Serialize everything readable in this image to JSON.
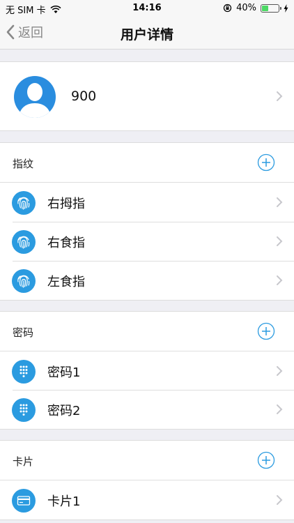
{
  "status_bar": {
    "carrier": "无 SIM 卡",
    "time": "14:16",
    "battery": "40%",
    "battery_level": 0.4
  },
  "nav": {
    "back_label": "返回",
    "title": "用户详情"
  },
  "profile": {
    "name": "900"
  },
  "sections": {
    "fingerprint": {
      "title": "指纹",
      "items": [
        "右拇指",
        "右食指",
        "左食指"
      ]
    },
    "password": {
      "title": "密码",
      "items": [
        "密码1",
        "密码2"
      ]
    },
    "card": {
      "title": "卡片",
      "items": [
        "卡片1"
      ]
    }
  },
  "colors": {
    "accent": "#2b9be0",
    "background": "#efeff4",
    "battery_green": "#4cd964"
  }
}
